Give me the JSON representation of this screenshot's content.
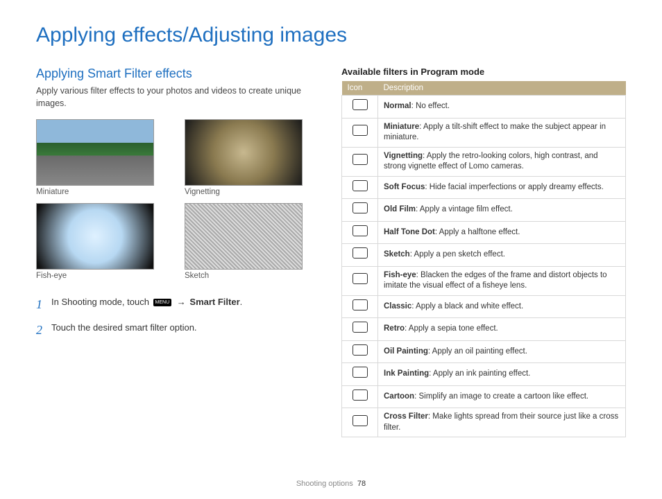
{
  "title": "Applying effects/Adjusting images",
  "left": {
    "subhead": "Applying Smart Filter effects",
    "intro": "Apply various filter effects to your photos and videos to create unique images.",
    "thumbs": [
      {
        "label": "Miniature"
      },
      {
        "label": "Vignetting"
      },
      {
        "label": "Fish-eye"
      },
      {
        "label": "Sketch"
      }
    ],
    "steps": {
      "s1_num": "1",
      "s1_a": "In Shooting mode, touch ",
      "s1_menu": "MENU",
      "s1_arrow": " → ",
      "s1_b": "Smart Filter",
      "s1_c": ".",
      "s2_num": "2",
      "s2": "Touch the desired smart filter option."
    }
  },
  "right": {
    "title": "Available filters in Program mode",
    "headers": {
      "icon": "Icon",
      "desc": "Description"
    },
    "rows": [
      {
        "name": "Normal",
        "desc": ": No effect."
      },
      {
        "name": "Miniature",
        "desc": ": Apply a tilt-shift effect to make the subject appear in miniature."
      },
      {
        "name": "Vignetting",
        "desc": ": Apply the retro-looking colors, high contrast, and strong vignette effect of Lomo cameras."
      },
      {
        "name": "Soft Focus",
        "desc": ": Hide facial imperfections or apply dreamy effects."
      },
      {
        "name": "Old Film",
        "desc": ": Apply a vintage film effect."
      },
      {
        "name": "Half Tone Dot",
        "desc": ": Apply a halftone effect."
      },
      {
        "name": "Sketch",
        "desc": ": Apply a pen sketch effect."
      },
      {
        "name": "Fish-eye",
        "desc": ": Blacken the edges of the frame and distort objects to imitate the visual effect of a fisheye lens."
      },
      {
        "name": "Classic",
        "desc": ": Apply a black and white effect."
      },
      {
        "name": "Retro",
        "desc": ": Apply a sepia tone effect."
      },
      {
        "name": "Oil Painting",
        "desc": ": Apply an oil painting effect."
      },
      {
        "name": "Ink Painting",
        "desc": ": Apply an ink painting effect."
      },
      {
        "name": "Cartoon",
        "desc": ": Simplify an image to create a cartoon like effect."
      },
      {
        "name": "Cross Filter",
        "desc": ": Make lights spread from their source just like a cross filter."
      }
    ]
  },
  "footer": {
    "section": "Shooting options",
    "page": "78"
  }
}
